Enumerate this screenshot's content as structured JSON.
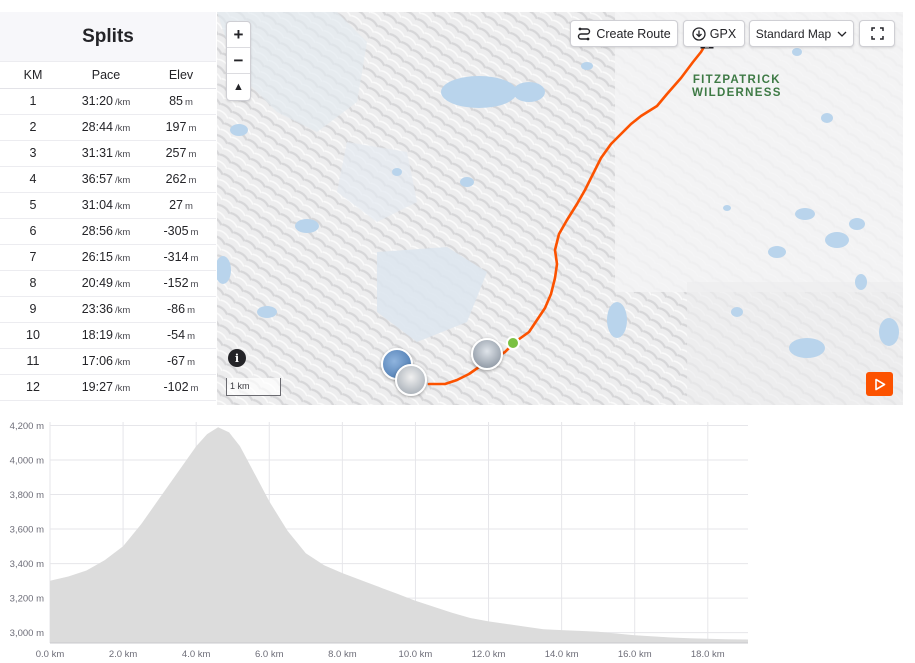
{
  "splits": {
    "title": "Splits",
    "columns": [
      "KM",
      "Pace",
      "Elev"
    ],
    "pace_unit": "/km",
    "elev_unit": "m",
    "rows": [
      {
        "km": "1",
        "pace": "31:20",
        "elev": "85"
      },
      {
        "km": "2",
        "pace": "28:44",
        "elev": "197"
      },
      {
        "km": "3",
        "pace": "31:31",
        "elev": "257"
      },
      {
        "km": "4",
        "pace": "36:57",
        "elev": "262"
      },
      {
        "km": "5",
        "pace": "31:04",
        "elev": "27"
      },
      {
        "km": "6",
        "pace": "28:56",
        "elev": "-305"
      },
      {
        "km": "7",
        "pace": "26:15",
        "elev": "-314"
      },
      {
        "km": "8",
        "pace": "20:49",
        "elev": "-152"
      },
      {
        "km": "9",
        "pace": "23:36",
        "elev": "-86"
      },
      {
        "km": "10",
        "pace": "18:19",
        "elev": "-54"
      },
      {
        "km": "11",
        "pace": "17:06",
        "elev": "-67"
      },
      {
        "km": "12",
        "pace": "19:27",
        "elev": "-102"
      }
    ]
  },
  "map": {
    "zoom_in": "+",
    "zoom_out": "−",
    "compass": "▲",
    "info": "i",
    "create_route_label": "Create Route",
    "gpx_label": "GPX",
    "map_style_label": "Standard Map",
    "area_label_line1": "FITZPATRICK",
    "area_label_line2": "WILDERNESS",
    "scale_label": "1 km",
    "route_color": "#fc5200",
    "start_marker_color": "#7ac143",
    "water_color": "#b9d4ec"
  },
  "chart_data": {
    "type": "area",
    "xlabel": "",
    "ylabel": "",
    "x_ticks": [
      "0.0 km",
      "2.0 km",
      "4.0 km",
      "6.0 km",
      "8.0 km",
      "10.0 km",
      "12.0 km",
      "14.0 km",
      "16.0 km",
      "18.0 km"
    ],
    "x_tick_values": [
      0,
      2,
      4,
      6,
      8,
      10,
      12,
      14,
      16,
      18
    ],
    "y_ticks": [
      "3,000 m",
      "3,200 m",
      "3,400 m",
      "3,600 m",
      "3,800 m",
      "4,000 m",
      "4,200 m"
    ],
    "y_tick_values": [
      3000,
      3200,
      3400,
      3600,
      3800,
      4000,
      4200
    ],
    "xlim": [
      0,
      19.1
    ],
    "ylim": [
      2940,
      4220
    ],
    "fill_color": "#dcdcdc",
    "grid": true,
    "x": [
      0,
      0.5,
      1.0,
      1.5,
      2.0,
      2.5,
      3.0,
      3.5,
      4.0,
      4.3,
      4.6,
      4.9,
      5.2,
      5.5,
      6.0,
      6.5,
      7.0,
      7.5,
      8.0,
      8.5,
      9.0,
      9.5,
      10.0,
      10.5,
      11.0,
      11.5,
      12.0,
      12.5,
      13.0,
      13.5,
      14.0,
      14.5,
      15.0,
      15.5,
      16.0,
      16.5,
      17.0,
      17.5,
      18.0,
      18.5,
      19.1
    ],
    "y": [
      3300,
      3325,
      3360,
      3420,
      3500,
      3630,
      3780,
      3930,
      4080,
      4150,
      4190,
      4160,
      4080,
      3960,
      3760,
      3590,
      3460,
      3390,
      3345,
      3305,
      3265,
      3225,
      3185,
      3150,
      3115,
      3085,
      3065,
      3050,
      3035,
      3020,
      3015,
      3010,
      3005,
      2995,
      2985,
      2978,
      2972,
      2968,
      2965,
      2962,
      2960
    ]
  }
}
